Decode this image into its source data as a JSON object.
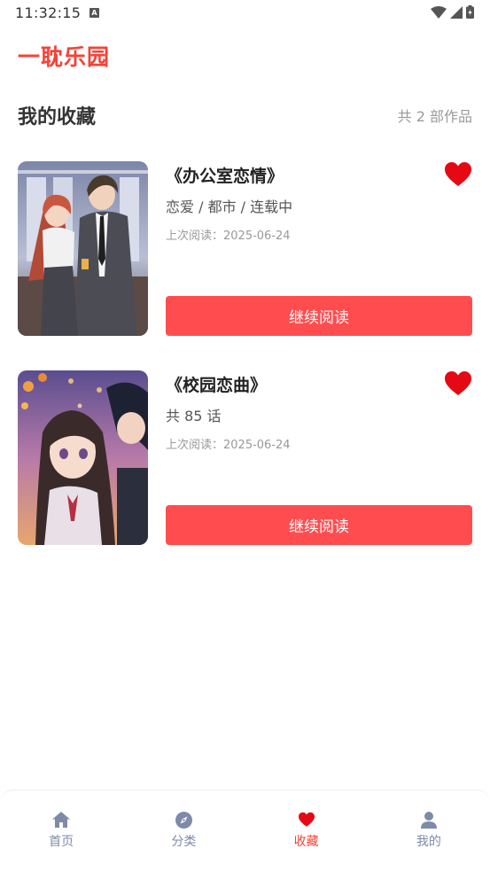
{
  "status": {
    "time": "11:32:15",
    "badge": "A"
  },
  "app": {
    "title": "一耽乐园"
  },
  "section": {
    "title": "我的收藏",
    "count": "共 2 部作品"
  },
  "favorites": [
    {
      "title": "《办公室恋情》",
      "meta": "恋爱 / 都市 / 连载中",
      "last_read": "上次阅读：2025-06-24",
      "favorited": true,
      "button_label": "继续阅读"
    },
    {
      "title": "《校园恋曲》",
      "meta": "共 85 话",
      "last_read": "上次阅读：2025-06-24",
      "favorited": true,
      "button_label": "继续阅读"
    }
  ],
  "nav": {
    "items": [
      {
        "label": "首页",
        "icon": "home-icon",
        "active": false
      },
      {
        "label": "分类",
        "icon": "compass-icon",
        "active": false
      },
      {
        "label": "收藏",
        "icon": "heart-icon",
        "active": true
      },
      {
        "label": "我的",
        "icon": "user-icon",
        "active": false
      }
    ]
  },
  "colors": {
    "accent": "#f44336",
    "button": "#ff4d4f",
    "heart": "#e50914",
    "nav_inactive": "#7e8aa8"
  }
}
